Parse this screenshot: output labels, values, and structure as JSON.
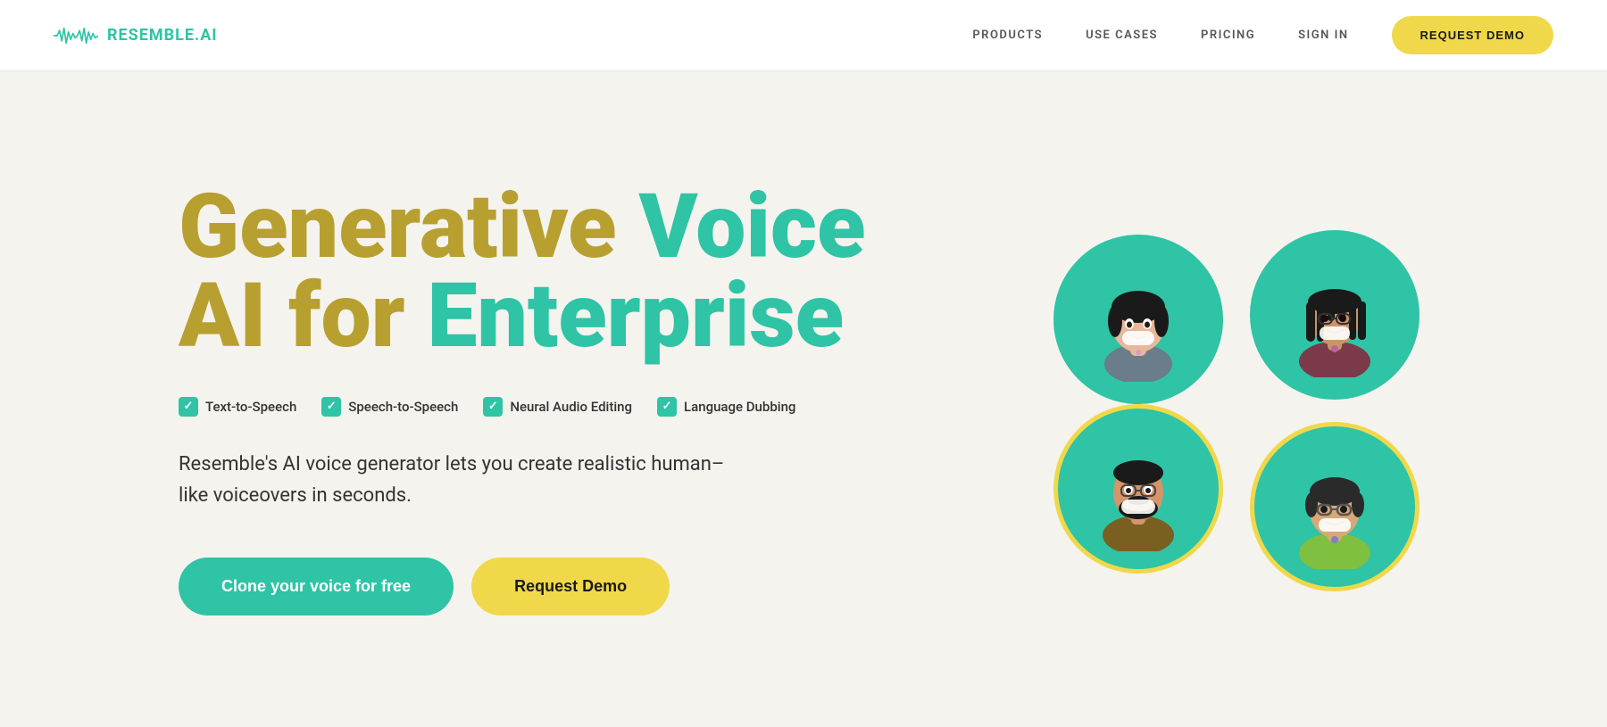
{
  "navbar": {
    "logo_text": "RESEMBLE.AI",
    "nav_items": [
      {
        "label": "PRODUCTS",
        "id": "products"
      },
      {
        "label": "USE CASES",
        "id": "use-cases"
      },
      {
        "label": "PRICING",
        "id": "pricing"
      },
      {
        "label": "SIGN IN",
        "id": "sign-in"
      }
    ],
    "cta_label": "REQUEST DEMO"
  },
  "hero": {
    "title_line1_part1": "Generative ",
    "title_line1_part2": "Voice",
    "title_line2_part1": "AI for ",
    "title_line2_part2": "Enterprise",
    "features": [
      {
        "label": "Text-to-Speech"
      },
      {
        "label": "Speech-to-Speech"
      },
      {
        "label": "Neural Audio Editing"
      },
      {
        "label": "Language Dubbing"
      }
    ],
    "description": "Resemble's AI voice generator lets you create realistic human–like voiceovers in seconds.",
    "btn_clone_label": "Clone your voice for free",
    "btn_demo_label": "Request Demo"
  },
  "avatars": [
    {
      "id": "avatar-1",
      "border": "teal",
      "description": "dark-haired woman with glasses"
    },
    {
      "id": "avatar-2",
      "border": "teal",
      "description": "woman with braids and glasses"
    },
    {
      "id": "avatar-3",
      "border": "yellow",
      "description": "bearded man"
    },
    {
      "id": "avatar-4",
      "border": "yellow",
      "description": "woman with short hair and glasses"
    }
  ],
  "colors": {
    "teal": "#2ec4a5",
    "yellow": "#f0d84a",
    "gold": "#b8a030",
    "text_dark": "#1a1a1a",
    "text_mid": "#333333",
    "bg": "#f5f3ee"
  }
}
